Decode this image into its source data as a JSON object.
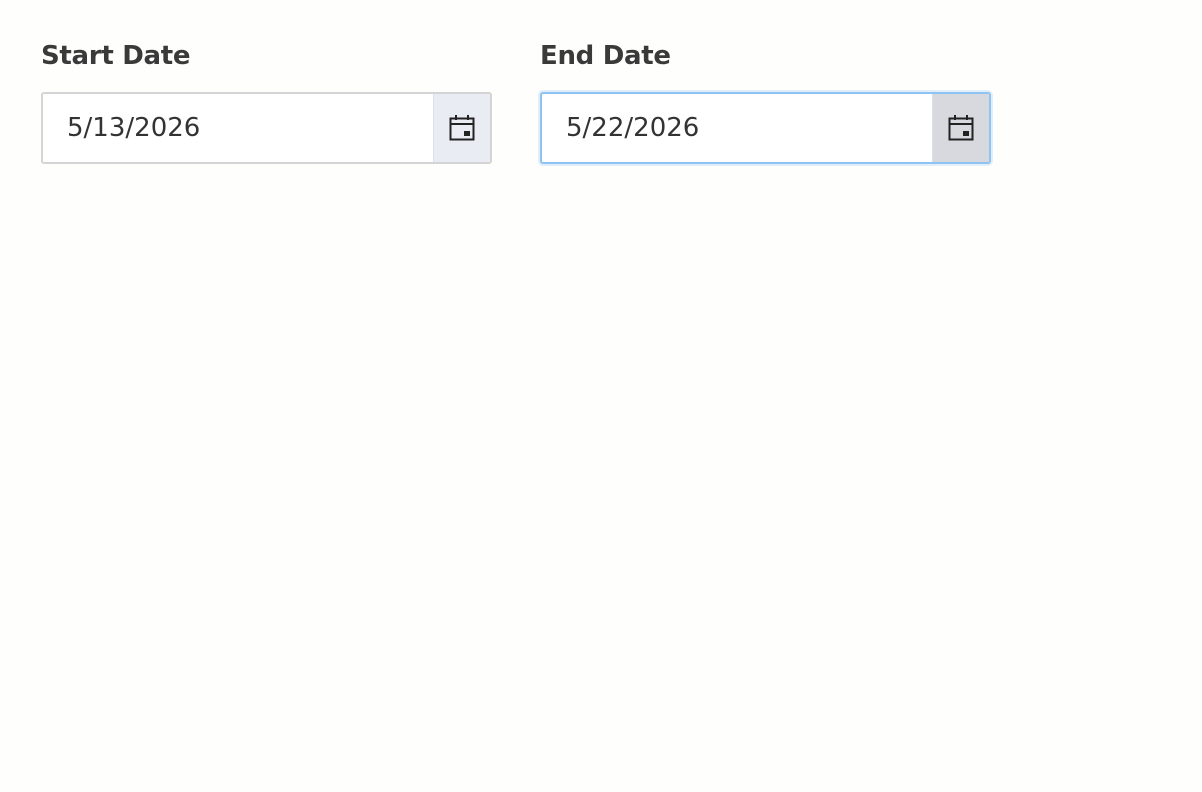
{
  "start_date": {
    "label": "Start Date",
    "value": "5/13/2026",
    "picker_icon": "calendar-icon"
  },
  "end_date": {
    "label": "End Date",
    "value": "5/22/2026",
    "picker_icon": "calendar-icon",
    "focused": true
  },
  "colors": {
    "background": "#fefefd",
    "text": "#333333",
    "border": "#d4d4d4",
    "focus_border": "#8ec3f3",
    "addon_background": "#e9ecf3",
    "addon_background_active": "#d7d9df"
  }
}
